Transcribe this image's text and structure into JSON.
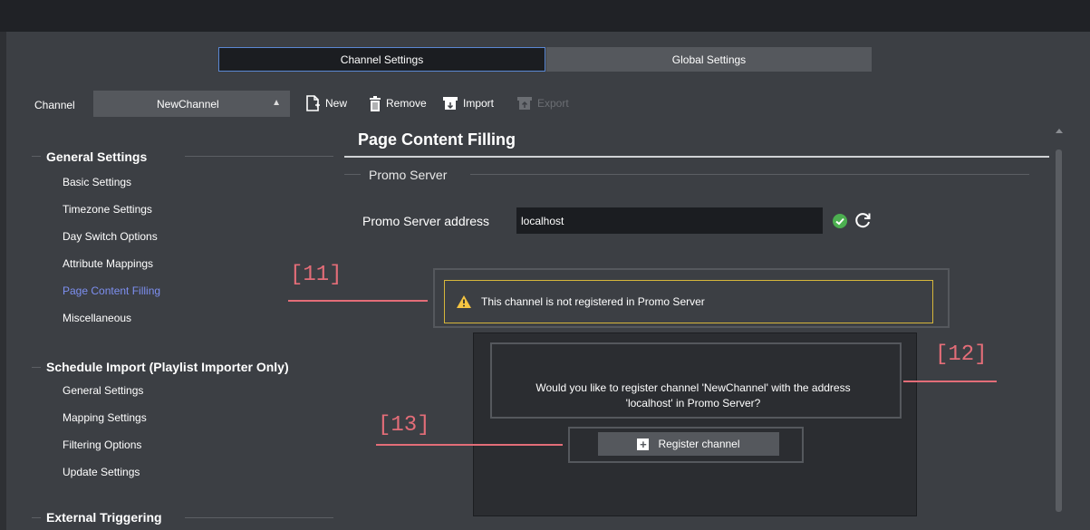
{
  "tabs": {
    "channel_settings": "Channel Settings",
    "global_settings": "Global Settings"
  },
  "channel": {
    "label": "Channel",
    "selected": "NewChannel"
  },
  "toolbar": {
    "new": "New",
    "remove": "Remove",
    "import": "Import",
    "export": "Export"
  },
  "nav": {
    "general": {
      "heading": "General Settings",
      "items": [
        "Basic Settings",
        "Timezone Settings",
        "Day Switch Options",
        "Attribute Mappings",
        "Page Content Filling",
        "Miscellaneous"
      ],
      "active": "Page Content Filling"
    },
    "schedule_import": {
      "heading": "Schedule Import (Playlist Importer Only)",
      "items": [
        "General Settings",
        "Mapping Settings",
        "Filtering Options",
        "Update Settings"
      ]
    },
    "external": {
      "heading": "External Triggering"
    }
  },
  "page": {
    "title": "Page Content Filling",
    "group": "Promo Server",
    "address_label": "Promo Server address",
    "address_value": "localhost",
    "warning": "This channel is not registered in Promo Server",
    "dialog_text_line1": "Would you like to register channel 'NewChannel' with the address",
    "dialog_text_line2": "'localhost' in Promo Server?",
    "register_button": "Register channel"
  },
  "annotations": {
    "a11": "[11]",
    "a12": "[12]",
    "a13": "[13]"
  },
  "colors": {
    "accent_active": "#7d8ff0",
    "annotation": "#e36d78",
    "warning_border": "#d6b63b",
    "ok": "#4caf50"
  }
}
